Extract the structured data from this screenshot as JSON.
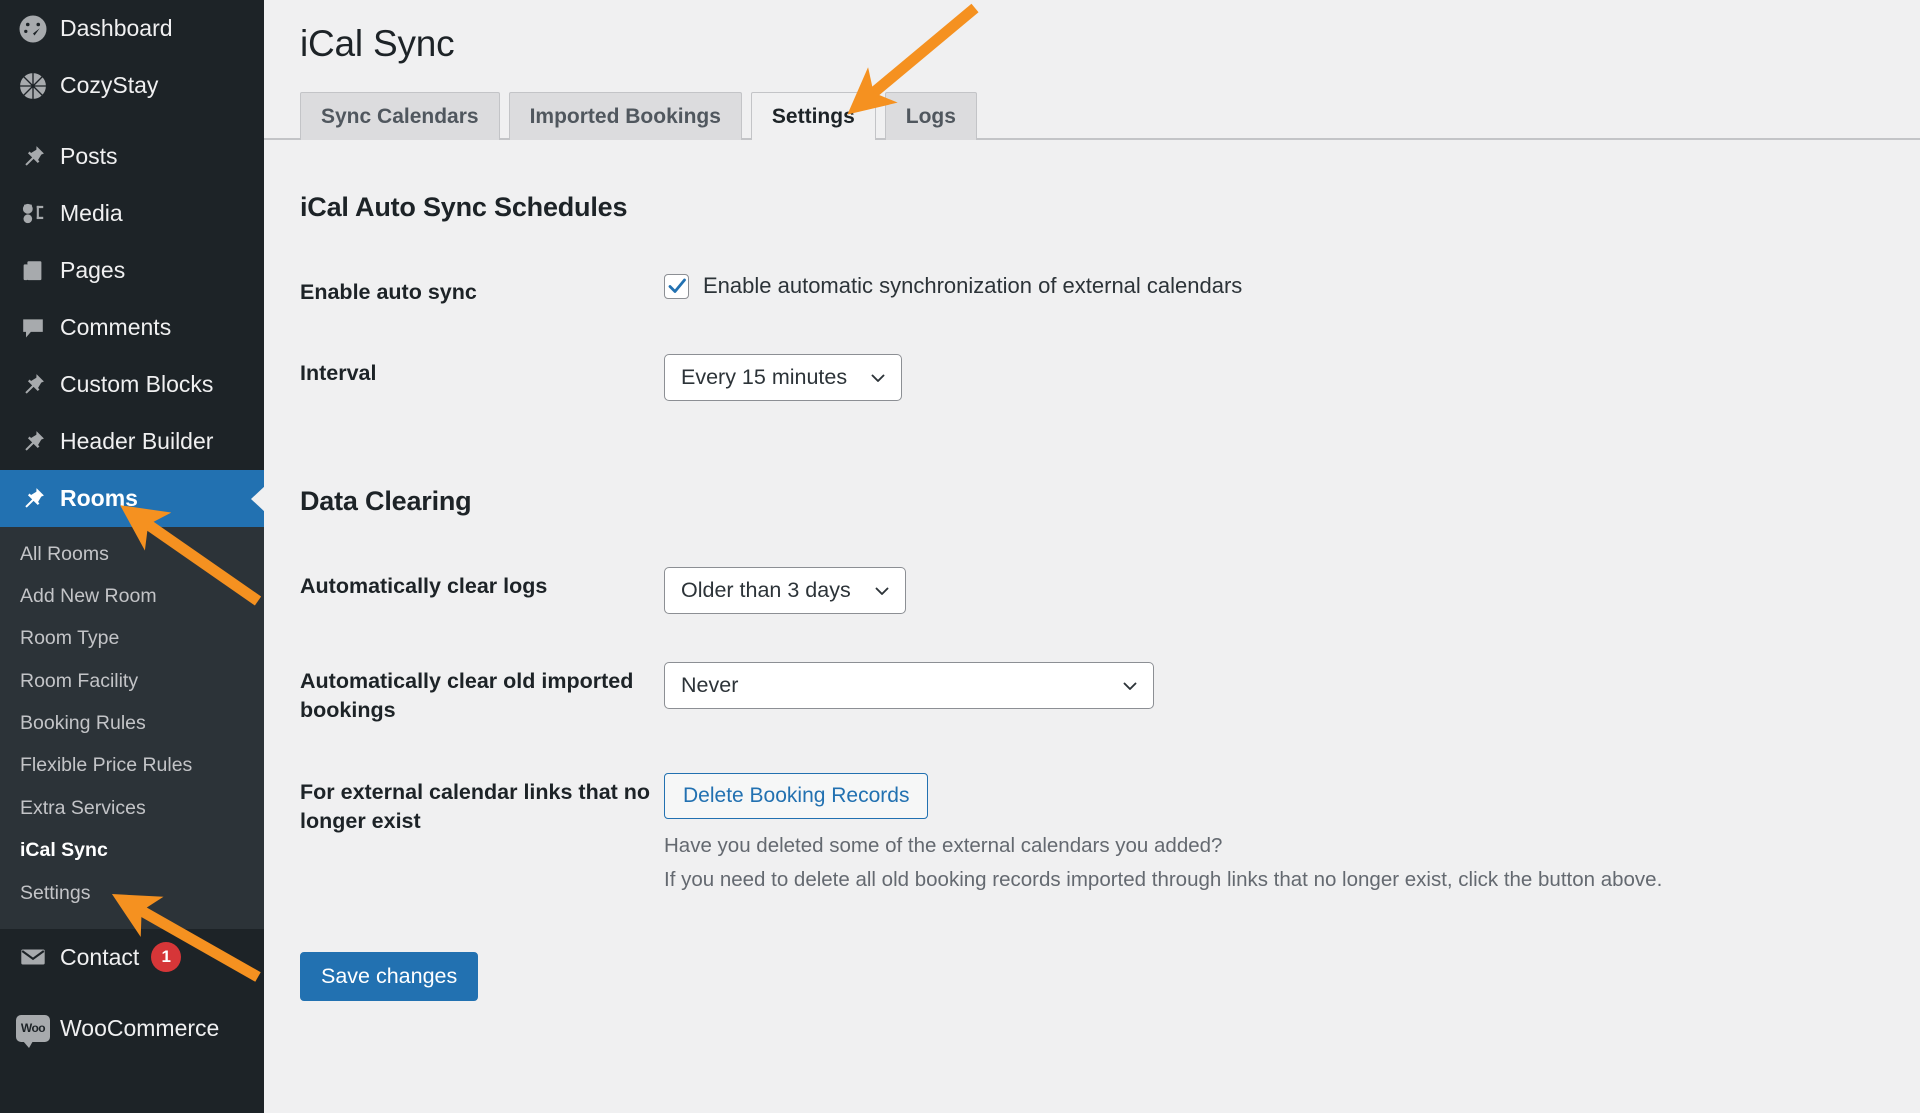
{
  "sidebar": {
    "items": [
      {
        "label": "Dashboard",
        "icon": "dashboard-icon",
        "current": false
      },
      {
        "label": "CozyStay",
        "icon": "cozystay-icon",
        "current": false
      },
      {
        "label": "Posts",
        "icon": "pin-icon",
        "current": false
      },
      {
        "label": "Media",
        "icon": "media-icon",
        "current": false
      },
      {
        "label": "Pages",
        "icon": "pages-icon",
        "current": false
      },
      {
        "label": "Comments",
        "icon": "comments-icon",
        "current": false
      },
      {
        "label": "Custom Blocks",
        "icon": "pin-icon",
        "current": false
      },
      {
        "label": "Header Builder",
        "icon": "pin-icon",
        "current": false
      },
      {
        "label": "Rooms",
        "icon": "pin-icon",
        "current": true
      }
    ],
    "submenu": [
      {
        "label": "All Rooms",
        "current": false
      },
      {
        "label": "Add New Room",
        "current": false
      },
      {
        "label": "Room Type",
        "current": false
      },
      {
        "label": "Room Facility",
        "current": false
      },
      {
        "label": "Booking Rules",
        "current": false
      },
      {
        "label": "Flexible Price Rules",
        "current": false
      },
      {
        "label": "Extra Services",
        "current": false
      },
      {
        "label": "iCal Sync",
        "current": true
      },
      {
        "label": "Settings",
        "current": false
      }
    ],
    "bottom_items": [
      {
        "label": "Contact",
        "icon": "mail-icon",
        "badge": "1"
      },
      {
        "label": "WooCommerce",
        "icon": "woocommerce-icon",
        "badge": ""
      }
    ]
  },
  "header": {
    "title": "iCal Sync"
  },
  "tabs": [
    {
      "label": "Sync Calendars",
      "active": false
    },
    {
      "label": "Imported Bookings",
      "active": false
    },
    {
      "label": "Settings",
      "active": true
    },
    {
      "label": "Logs",
      "active": false
    }
  ],
  "sections": {
    "auto_sync": {
      "title": "iCal Auto Sync Schedules",
      "enable_label": "Enable auto sync",
      "enable_checkbox_label": "Enable automatic synchronization of external calendars",
      "enable_checked": true,
      "interval_label": "Interval",
      "interval_value": "Every 15 minutes"
    },
    "data_clearing": {
      "title": "Data Clearing",
      "clear_logs_label": "Automatically clear logs",
      "clear_logs_value": "Older than 3 days",
      "clear_bookings_label": "Automatically clear old imported bookings",
      "clear_bookings_value": "Never",
      "external_links_label": "For external calendar links that no longer exist",
      "delete_button": "Delete Booking Records",
      "help_line1": "Have you deleted some of the external calendars you added?",
      "help_line2": "If you need to delete all old booking records imported through links that no longer exist, click the button above."
    }
  },
  "footer": {
    "save_label": "Save changes"
  },
  "colors": {
    "accent_blue": "#2271b1",
    "sidebar_bg": "#1d2327",
    "submenu_bg": "#2c3338",
    "badge_red": "#d63638",
    "annotation_orange": "#f59120",
    "page_bg": "#f0f0f1"
  }
}
